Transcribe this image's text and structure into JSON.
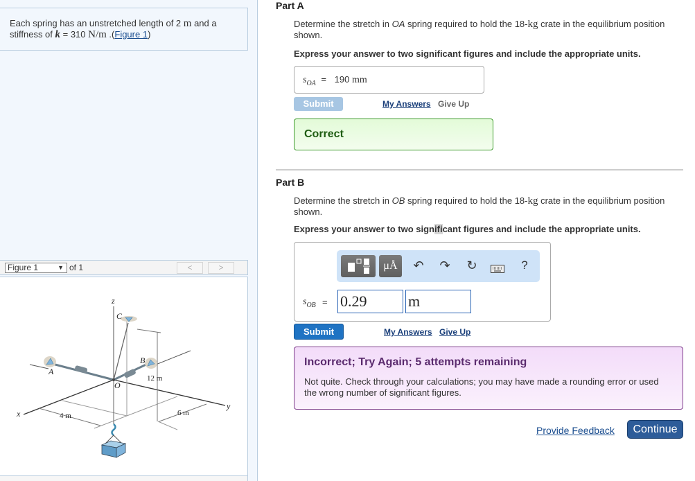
{
  "intro": {
    "text_1": "Each spring has an unstretched length of 2 ",
    "unit_m": "m",
    "text_2": " and a",
    "text_3": "stiffness of ",
    "k_symbol": "k",
    "text_4": " = 310 ",
    "unit_Nm": "N/m",
    "text_5": " .(",
    "figure_link": "Figure 1",
    "text_6": ")"
  },
  "figure_nav": {
    "selected": "Figure 1",
    "of_label": "of 1",
    "prev_icon": "<",
    "next_icon": ">"
  },
  "figure": {
    "labels": {
      "z": "z",
      "x": "x",
      "y": "y",
      "A": "A",
      "B": "B",
      "C": "C",
      "O": "O",
      "dim_12": "12 m",
      "dim_4": "4 m",
      "dim_6": "6 m"
    }
  },
  "part_a": {
    "title": "Part A",
    "prompt_1": "Determine the stretch in ",
    "prompt_var": "OA",
    "prompt_2": " spring required to hold the 18-",
    "prompt_unit": "kg",
    "prompt_3": " crate in the equilibrium position shown.",
    "express": "Express your answer to two significant figures and include the appropriate units.",
    "var_main": "s",
    "var_sub": "OA",
    "equals": "=",
    "answer_value": "190",
    "answer_unit": "mm",
    "submit_label": "Submit",
    "my_answers_label": "My Answers",
    "give_up_label": "Give Up",
    "result": "Correct"
  },
  "part_b": {
    "title": "Part B",
    "prompt_1": "Determine the stretch in ",
    "prompt_var": "OB",
    "prompt_2": " spring required to hold the 18-",
    "prompt_unit": "kg",
    "prompt_3": " crate in the equilibrium position shown.",
    "express_1": "Express your answer to two sign",
    "express_hl": "ifi",
    "express_2": "cant figures and include the appropriate units.",
    "toolbar": {
      "templates_icon": "templates-icon",
      "units_label": "μÅ",
      "undo_icon": "↶",
      "redo_icon": "↷",
      "reset_icon": "↻",
      "keyboard_icon": "keyboard-icon",
      "help_label": "?"
    },
    "var_main": "s",
    "var_sub": "OB",
    "equals": "=",
    "value_input": "0.29",
    "unit_input": "m",
    "submit_label": "Submit",
    "my_answers_label": "My Answers",
    "give_up_label": "Give Up",
    "result_title": "Incorrect; Try Again; 5 attempts remaining",
    "result_body": "Not quite. Check through your calculations; you may have made a rounding error or used the wrong number of significant figures."
  },
  "footer": {
    "feedback_label": "Provide Feedback",
    "continue_label": "Continue"
  }
}
